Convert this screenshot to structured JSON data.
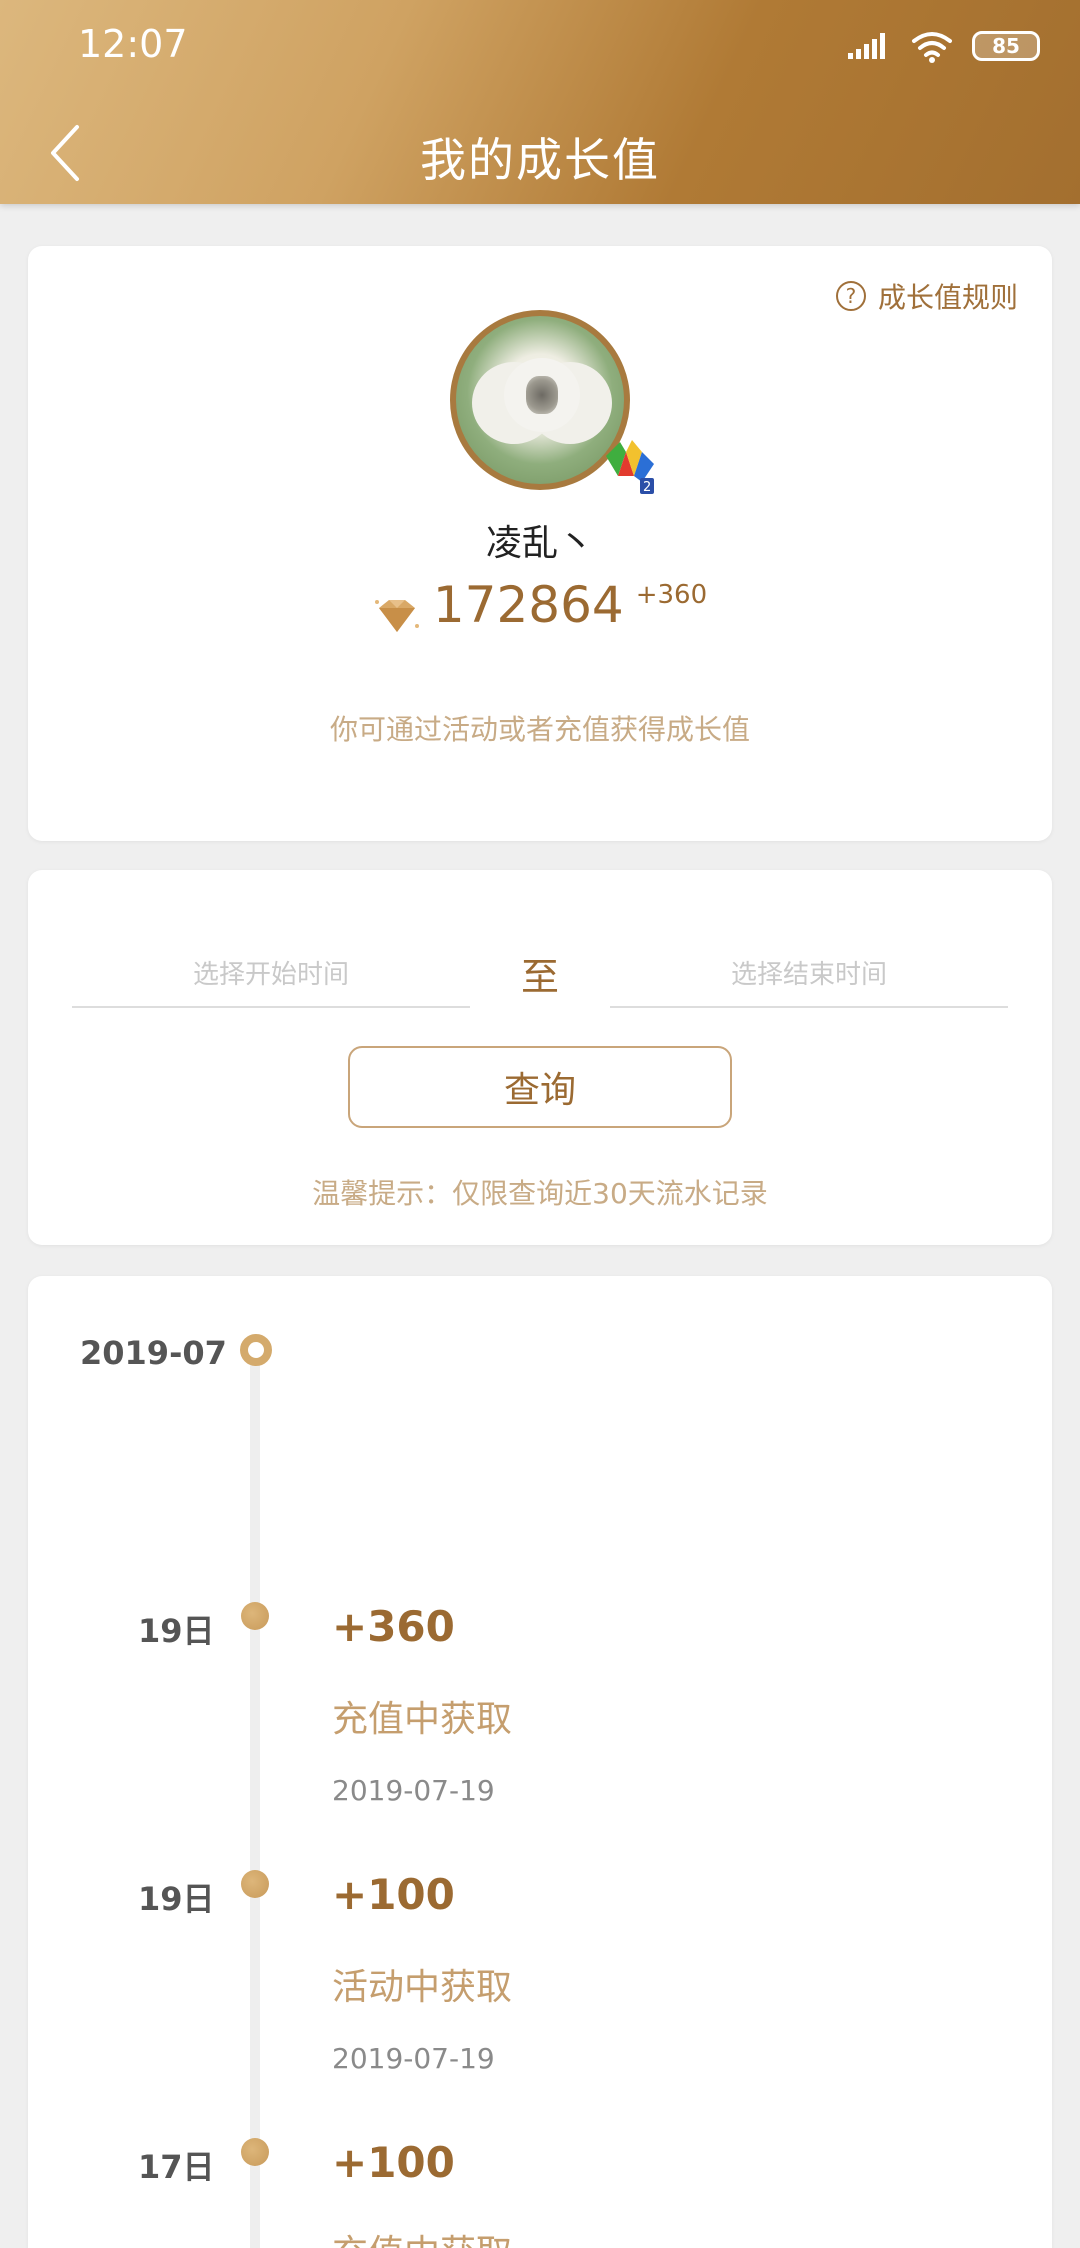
{
  "status_bar": {
    "time": "12:07",
    "battery": "85",
    "icons": [
      "signal-icon",
      "wifi-icon",
      "battery-icon"
    ]
  },
  "header": {
    "title": "我的成长值",
    "back_icon": "chevron-left-icon"
  },
  "profile": {
    "rules_label": "成长值规则",
    "username": "凌乱丶",
    "growth_value": "172864",
    "growth_delta": "+360",
    "tip": "你可通过活动或者充值获得成长值"
  },
  "filter": {
    "start_placeholder": "选择开始时间",
    "separator": "至",
    "end_placeholder": "选择结束时间",
    "query_label": "查询",
    "hint": "温馨提示：仅限查询近30天流水记录"
  },
  "records": {
    "month": "2019-07",
    "items": [
      {
        "day": "19日",
        "amount": "+360",
        "source": "充值中获取",
        "date": "2019-07-19"
      },
      {
        "day": "19日",
        "amount": "+100",
        "source": "活动中获取",
        "date": "2019-07-19"
      },
      {
        "day": "17日",
        "amount": "+100",
        "source": "充值中获取",
        "date": ""
      }
    ]
  },
  "colors": {
    "accent": "#9b6a32",
    "header_gradient_start": "#dcb77d",
    "header_gradient_end": "#a36f2f",
    "muted_gold": "#c8ab86",
    "background": "#efefef"
  }
}
